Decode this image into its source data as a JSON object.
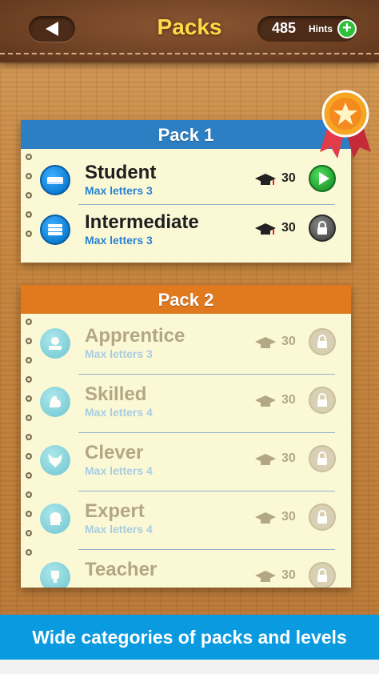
{
  "header": {
    "title": "Packs",
    "hints_count": "485",
    "hints_label": "Hints",
    "hints_plus": "+"
  },
  "packs": [
    {
      "header": "Pack 1",
      "header_color": "#2d7fc4",
      "levels": [
        {
          "name": "Student",
          "sub": "Max letters 3",
          "count": "30",
          "state": "play",
          "icon": "book-icon"
        },
        {
          "name": "Intermediate",
          "sub": "Max letters 3",
          "count": "30",
          "state": "locked",
          "icon": "books-stack-icon"
        }
      ]
    },
    {
      "header": "Pack 2",
      "header_color": "#e1791f",
      "levels": [
        {
          "name": "Apprentice",
          "sub": "Max letters 3",
          "count": "30",
          "state": "locked",
          "icon": "apple-books-icon"
        },
        {
          "name": "Skilled",
          "sub": "Max letters 4",
          "count": "30",
          "state": "locked",
          "icon": "muscle-arm-icon"
        },
        {
          "name": "Clever",
          "sub": "Max letters 4",
          "count": "30",
          "state": "locked",
          "icon": "fox-icon"
        },
        {
          "name": "Expert",
          "sub": "Max letters 4",
          "count": "30",
          "state": "locked",
          "icon": "brain-head-icon"
        },
        {
          "name": "Teacher",
          "sub": "",
          "count": "30",
          "state": "locked",
          "icon": "trophy-icon"
        }
      ]
    }
  ],
  "banner": {
    "text": "Wide categories of packs and levels"
  },
  "colors": {
    "accent_blue": "#0a9adf",
    "title_yellow": "#ffd84a",
    "play_green": "#2fbf3a"
  }
}
